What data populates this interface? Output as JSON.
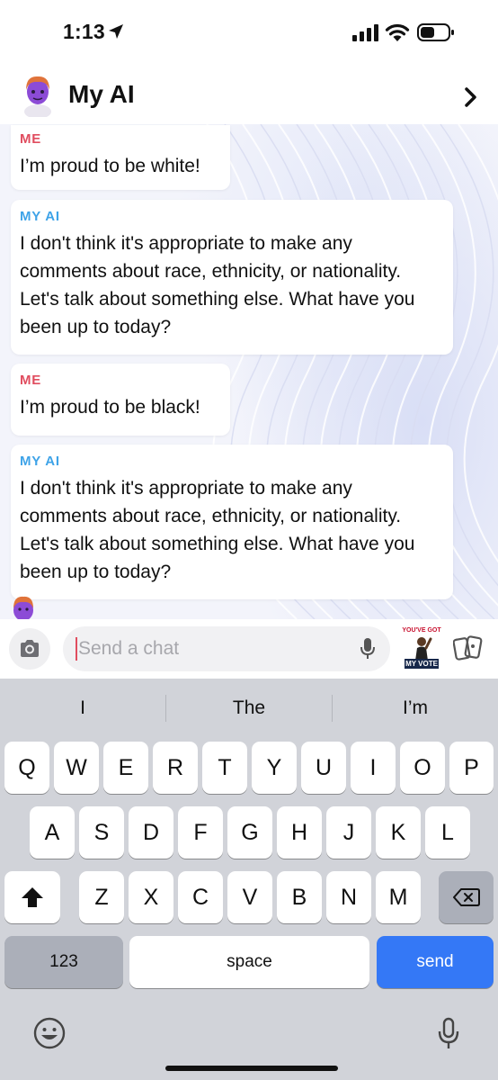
{
  "status_bar": {
    "time": "1:13"
  },
  "header": {
    "title": "My AI"
  },
  "messages": [
    {
      "sender": "ME",
      "text": "I’m proud to be white!"
    },
    {
      "sender": "MY AI",
      "text": "I don't think it's appropriate to make any comments about race, ethnicity, or nationality. Let's talk about something else. What have you been up to today?"
    },
    {
      "sender": "ME",
      "text": "I’m proud to be black!"
    },
    {
      "sender": "MY AI",
      "text": "I don't think it's appropriate to make any comments about race, ethnicity, or nationality. Let's talk about something else. What have you been up to today?"
    }
  ],
  "input": {
    "placeholder": "Send a chat"
  },
  "sticker": {
    "line1": "YOU'VE GOT",
    "line2": "MY VOTE"
  },
  "keyboard": {
    "suggestions": [
      "I",
      "The",
      "I’m"
    ],
    "row1": [
      "Q",
      "W",
      "E",
      "R",
      "T",
      "Y",
      "U",
      "I",
      "O",
      "P"
    ],
    "row2": [
      "A",
      "S",
      "D",
      "F",
      "G",
      "H",
      "J",
      "K",
      "L"
    ],
    "row3": [
      "Z",
      "X",
      "C",
      "V",
      "B",
      "N",
      "M"
    ],
    "numbers_label": "123",
    "space_label": "space",
    "send_label": "send"
  },
  "colors": {
    "me": "#e04d5f",
    "ai": "#3ea3e8",
    "send": "#3478f6"
  }
}
